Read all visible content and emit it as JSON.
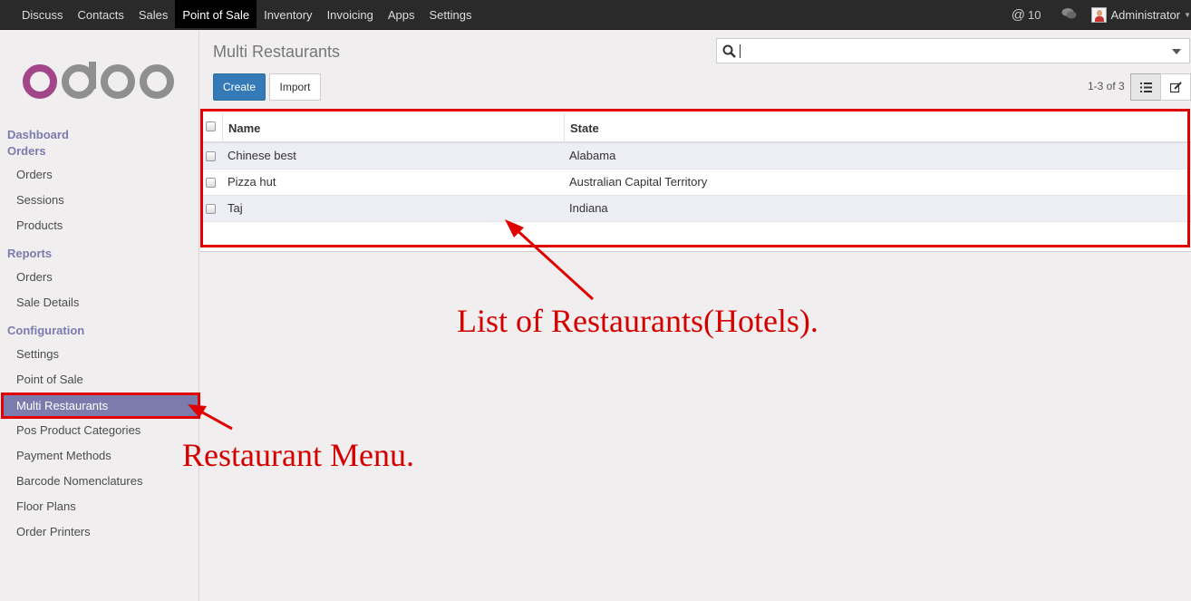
{
  "topbar": {
    "menu": [
      "Discuss",
      "Contacts",
      "Sales",
      "Point of Sale",
      "Inventory",
      "Invoicing",
      "Apps",
      "Settings"
    ],
    "active_index": 3,
    "mentions_count": "10",
    "user_name": "Administrator"
  },
  "sidebar": {
    "sections": {
      "dashboard": "Dashboard",
      "orders": "Orders",
      "reports": "Reports",
      "configuration": "Configuration"
    },
    "orders_items": [
      "Orders",
      "Sessions",
      "Products"
    ],
    "reports_items": [
      "Orders",
      "Sale Details"
    ],
    "configuration_items": [
      "Settings",
      "Point of Sale",
      "Multi Restaurants",
      "Pos Product Categories",
      "Payment Methods",
      "Barcode Nomenclatures",
      "Floor Plans",
      "Order Printers"
    ],
    "active_item": "Multi Restaurants"
  },
  "main": {
    "breadcrumb": "Multi Restaurants",
    "search_placeholder": "",
    "create_label": "Create",
    "import_label": "Import",
    "pager": "1-3 of 3",
    "columns": [
      "Name",
      "State"
    ],
    "rows": [
      {
        "name": "Chinese best",
        "state": "Alabama"
      },
      {
        "name": "Pizza hut",
        "state": "Australian Capital Territory"
      },
      {
        "name": "Taj",
        "state": "Indiana"
      }
    ]
  },
  "annotations": {
    "list_label": "List of Restaurants(Hotels).",
    "menu_label": "Restaurant Menu.",
    "color": "#e00000"
  },
  "colors": {
    "topbar_bg": "#2a2a2a",
    "accent": "#7c7bad",
    "primary_button": "#337ab7"
  }
}
